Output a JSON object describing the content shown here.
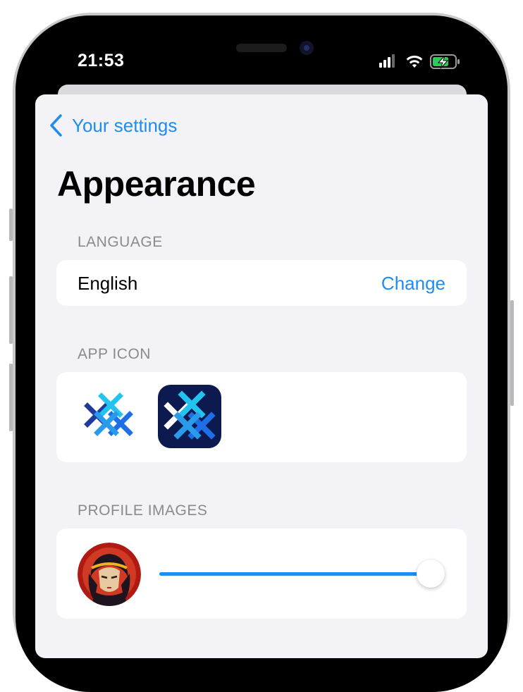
{
  "status_bar": {
    "time": "21:53",
    "icons": [
      "signal-icon",
      "wifi-icon",
      "battery-charging-icon"
    ]
  },
  "nav": {
    "back_label": "Your settings",
    "back_icon": "chevron-left-icon"
  },
  "page": {
    "title": "Appearance"
  },
  "sections": {
    "language": {
      "header": "LANGUAGE",
      "value": "English",
      "action": "Change"
    },
    "app_icon": {
      "header": "APP ICON",
      "options": [
        {
          "icon": "app-icon-light",
          "background": "#ffffff"
        },
        {
          "icon": "app-icon-dark",
          "background": "#0d1a50"
        }
      ]
    },
    "profile_images": {
      "header": "PROFILE IMAGES",
      "avatar": "avatar-icon",
      "slider_value": 1.0
    }
  },
  "colors": {
    "accent": "#1f8cf0",
    "background": "#f2f2f7",
    "card": "#ffffff",
    "section_header": "#8a8a8e"
  }
}
